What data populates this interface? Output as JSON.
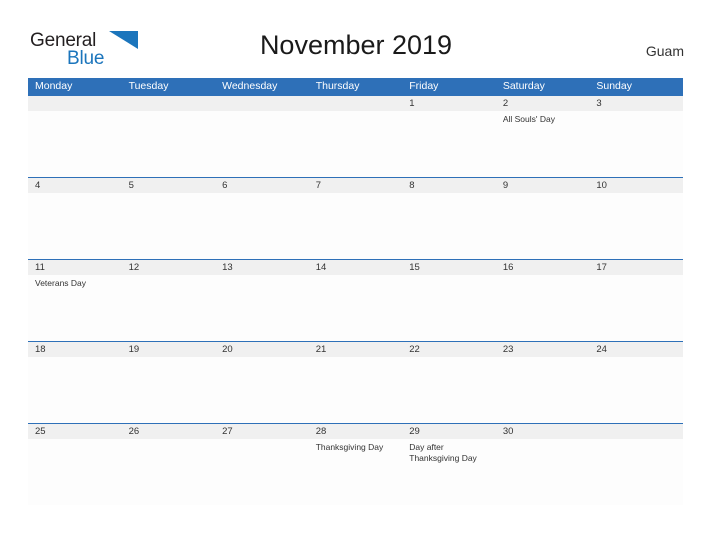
{
  "brand": {
    "name_part1": "General",
    "name_part2": "Blue",
    "flag_color": "#1B75BC",
    "text_color": "#231F20"
  },
  "header": {
    "title": "November 2019",
    "location": "Guam"
  },
  "theme": {
    "header_blue": "#2E70B8",
    "date_strip_gray": "#F0F0F0",
    "body_white": "#FDFDFD",
    "text_dark": "#333333"
  },
  "calendar": {
    "weekdays": [
      "Monday",
      "Tuesday",
      "Wednesday",
      "Thursday",
      "Friday",
      "Saturday",
      "Sunday"
    ],
    "weeks": [
      {
        "dates": [
          "",
          "",
          "",
          "",
          "1",
          "2",
          "3"
        ],
        "events": [
          "",
          "",
          "",
          "",
          "",
          "All Souls' Day",
          ""
        ]
      },
      {
        "dates": [
          "4",
          "5",
          "6",
          "7",
          "8",
          "9",
          "10"
        ],
        "events": [
          "",
          "",
          "",
          "",
          "",
          "",
          ""
        ]
      },
      {
        "dates": [
          "11",
          "12",
          "13",
          "14",
          "15",
          "16",
          "17"
        ],
        "events": [
          "Veterans Day",
          "",
          "",
          "",
          "",
          "",
          ""
        ]
      },
      {
        "dates": [
          "18",
          "19",
          "20",
          "21",
          "22",
          "23",
          "24"
        ],
        "events": [
          "",
          "",
          "",
          "",
          "",
          "",
          ""
        ]
      },
      {
        "dates": [
          "25",
          "26",
          "27",
          "28",
          "29",
          "30",
          ""
        ],
        "events": [
          "",
          "",
          "",
          "Thanksgiving Day",
          "Day after Thanksgiving Day",
          "",
          ""
        ]
      }
    ]
  }
}
